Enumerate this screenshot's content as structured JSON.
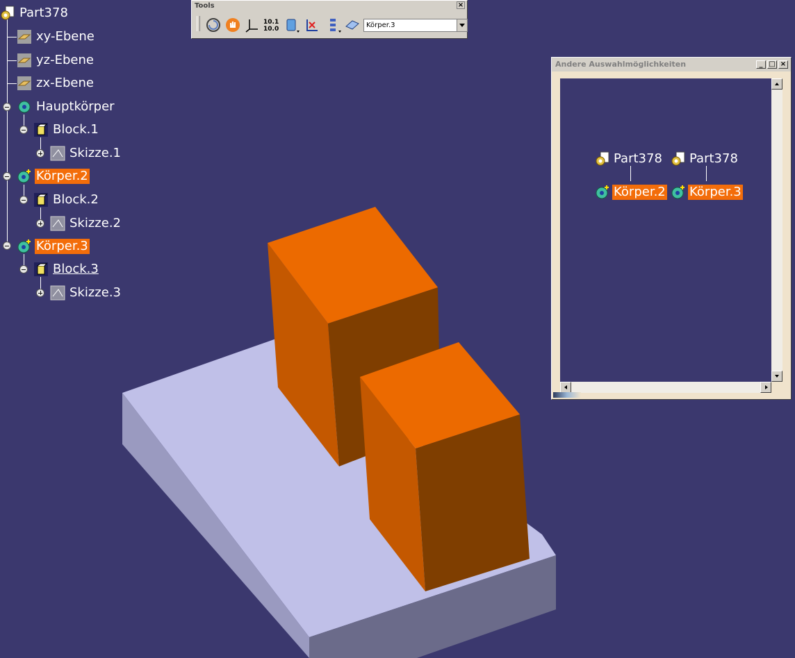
{
  "tree": {
    "root": "Part378",
    "items": [
      {
        "label": "xy-Ebene"
      },
      {
        "label": "yz-Ebene"
      },
      {
        "label": "zx-Ebene"
      },
      {
        "label": "Hauptkörper"
      },
      {
        "label": "Block.1"
      },
      {
        "label": "Skizze.1"
      },
      {
        "label": "Körper.2"
      },
      {
        "label": "Block.2"
      },
      {
        "label": "Skizze.2"
      },
      {
        "label": "Körper.3"
      },
      {
        "label": "Block.3"
      },
      {
        "label": "Skizze.3"
      }
    ]
  },
  "toolbar": {
    "title": "Tools",
    "close": "×",
    "combo_value": "Körper.3",
    "buttons": [
      "rotate-view-icon",
      "hand-select-icon",
      "axis-system-icon",
      "numeric-values-icon",
      "body-stack-icon",
      "scan-icon",
      "tree-list-icon",
      "body-select-icon"
    ]
  },
  "dialog": {
    "title": "Andere Auswahlmöglichkeiten",
    "min": "_",
    "max": "□",
    "close": "×",
    "nodes": [
      {
        "parent": "Part378",
        "child": "Körper.2"
      },
      {
        "parent": "Part378",
        "child": "Körper.3"
      }
    ]
  },
  "colors": {
    "background": "#3b386e",
    "highlight": "#f36d0a",
    "box_top": "#ec6a00",
    "box_left": "#c45800",
    "box_right": "#7f3e00",
    "plate_top": "#c0c0e8",
    "plate_front": "#6b6b8a",
    "plate_left": "#9a9ac0"
  }
}
